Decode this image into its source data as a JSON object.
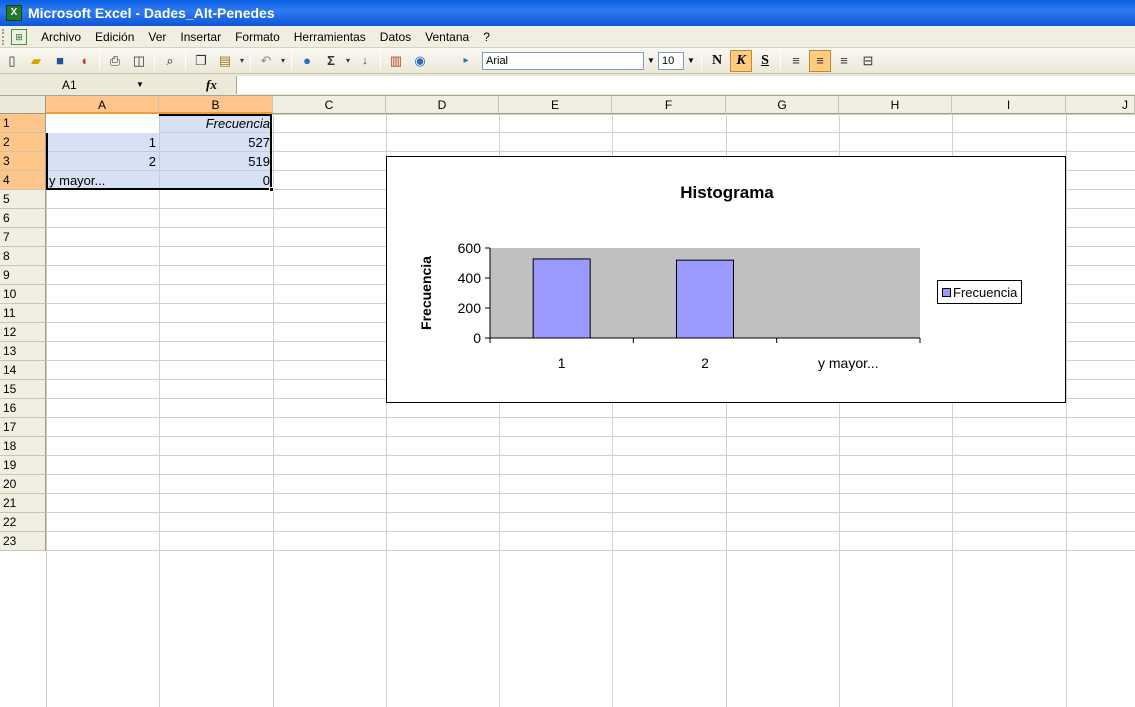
{
  "window": {
    "title": "Microsoft Excel - Dades_Alt-Penedes",
    "app_icon": "excel-icon"
  },
  "menu": {
    "items": [
      "Archivo",
      "Edición",
      "Ver",
      "Insertar",
      "Formato",
      "Herramientas",
      "Datos",
      "Ventana",
      "?"
    ]
  },
  "toolbar": {
    "font_name": "Arial",
    "font_size": "10",
    "bold_label": "N",
    "italic_label": "K",
    "underline_label": "S",
    "sum_label": "Σ"
  },
  "formula_bar": {
    "name_box": "A1",
    "fx_label": "fx",
    "formula": ""
  },
  "sheet": {
    "columns": [
      "A",
      "B",
      "C",
      "D",
      "E",
      "F",
      "G",
      "H",
      "I",
      "J"
    ],
    "rows": [
      "1",
      "2",
      "3",
      "4",
      "5",
      "6",
      "7",
      "8",
      "9",
      "10",
      "11",
      "12",
      "13",
      "14",
      "15",
      "16",
      "17",
      "18",
      "19",
      "20",
      "21",
      "22",
      "23"
    ],
    "cells": {
      "B1": "Frecuencia",
      "A2": "1",
      "B2": "527",
      "A3": "2",
      "B3": "519",
      "A4": "y mayor...",
      "B4": "0"
    }
  },
  "chart_data": {
    "type": "bar",
    "title": "Histograma",
    "xlabel": "",
    "ylabel": "Frecuencia",
    "categories": [
      "1",
      "2",
      "y mayor..."
    ],
    "series": [
      {
        "name": "Frecuencia",
        "values": [
          527,
          519,
          0
        ],
        "color": "#9999ff"
      }
    ],
    "ylim": [
      0,
      600
    ],
    "yticks": [
      "0",
      "200",
      "400",
      "600"
    ],
    "plot_background": "#c0c0c0",
    "legend": "right"
  }
}
